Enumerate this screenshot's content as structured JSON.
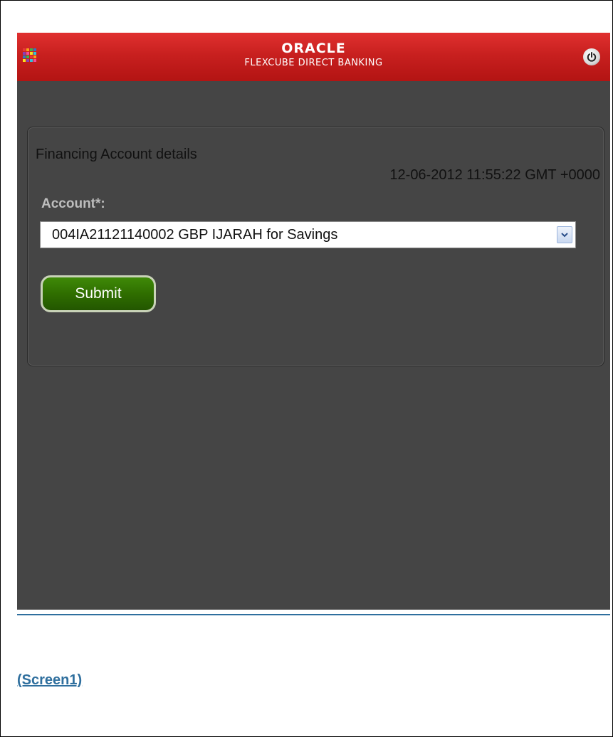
{
  "header": {
    "brand_logo": "ORACLE",
    "brand_subtitle": "FLEXCUBE DIRECT BANKING",
    "menu_icon": "grid-menu-icon",
    "power_icon": "power-icon",
    "menu_icon_colors": [
      "#e83838",
      "#f7a21b",
      "#39b54a",
      "#2b79c8",
      "#8a3fb5",
      "#f04e98",
      "#f9e11c",
      "#34c3d8",
      "#2b79c8",
      "#39b54a",
      "#e83838",
      "#f7a21b",
      "#f9e11c",
      "#8a3fb5",
      "#34c3d8",
      "#f04e98"
    ]
  },
  "panel": {
    "title": "Financing Account details",
    "timestamp": "12-06-2012 11:55:22 GMT +0000",
    "account_label": "Account*:",
    "account_selected": "004IA21121140002 GBP IJARAH for Savings",
    "submit_label": "Submit"
  },
  "caption": "(Screen1)",
  "colors": {
    "header_red": "#c8201f",
    "body_bg": "#454545",
    "submit_green": "#2f6e00",
    "caption_blue": "#2f6f9e"
  }
}
